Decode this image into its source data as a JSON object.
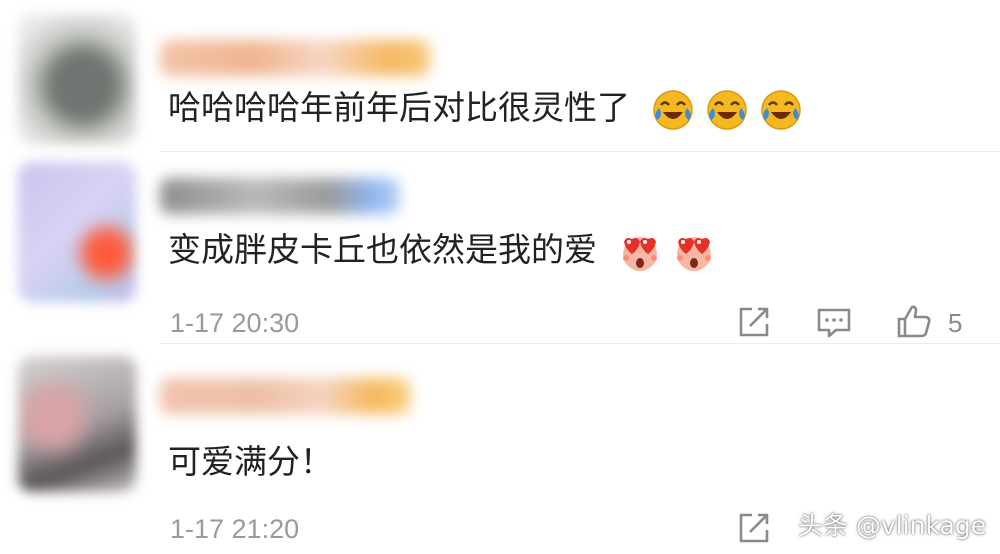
{
  "comments": [
    {
      "text": "哈哈哈哈年前年后对比很灵性了",
      "emoji": [
        "laugh-cry-icon",
        "laugh-cry-icon",
        "laugh-cry-icon"
      ]
    },
    {
      "text": "变成胖皮卡丘也依然是我的爱",
      "emoji": [
        "heart-eyes-icon",
        "heart-eyes-icon"
      ],
      "timestamp": "1-17 20:30",
      "like_count": "5"
    },
    {
      "text": "可爱满分！",
      "timestamp": "1-17 21:20"
    }
  ],
  "watermark": "头条 @vlinkage",
  "colors": {
    "text": "#222222",
    "meta": "#9a9a9a",
    "icon": "#8a8a8a",
    "emoji_yellow": "#f6b820",
    "emoji_blue": "#3b8be0"
  }
}
